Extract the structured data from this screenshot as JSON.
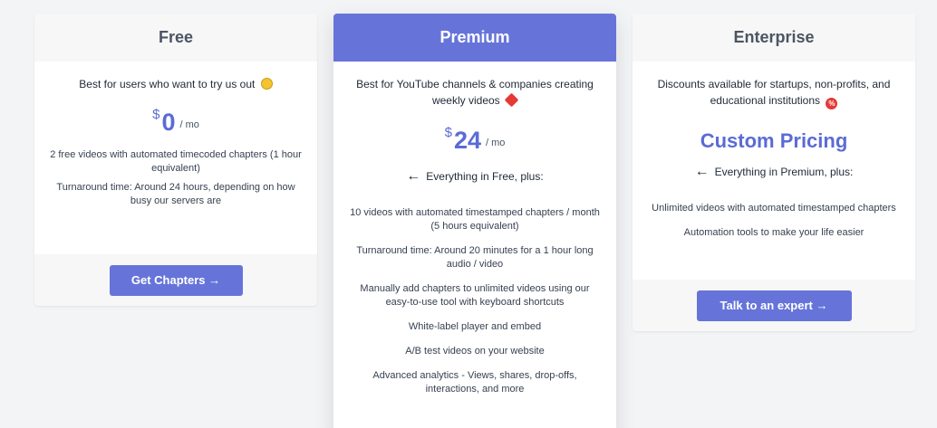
{
  "plans": {
    "free": {
      "name": "Free",
      "tagline": "Best for users who want to try us out",
      "currency": "$",
      "amount": "0",
      "period": "/ mo",
      "features": [
        "2 free videos with automated timecoded chapters (1 hour equivalent)",
        "Turnaround time: Around 24 hours, depending on how busy our servers are"
      ],
      "cta": "Get Chapters →"
    },
    "premium": {
      "name": "Premium",
      "tagline": "Best for YouTube channels & companies creating weekly videos",
      "currency": "$",
      "amount": "24",
      "period": "/ mo",
      "plus": "Everything in Free, plus:",
      "features": [
        "10 videos with automated timestamped chapters / month (5 hours equivalent)",
        "Turnaround time: Around 20 minutes for a 1 hour long audio / video",
        "Manually add chapters to unlimited videos using our easy-to-use tool with keyboard shortcuts",
        "White-label player and embed",
        "A/B test videos on your website",
        "Advanced analytics - Views, shares, drop-offs, interactions, and more"
      ]
    },
    "enterprise": {
      "name": "Enterprise",
      "tagline": "Discounts available for startups, non-profits, and educational institutions",
      "price_label": "Custom Pricing",
      "plus": "Everything in Premium, plus:",
      "features": [
        "Unlimited videos with automated timestamped chapters",
        "Automation tools to make your life easier"
      ],
      "cta": "Talk to an expert →"
    }
  },
  "icons": {
    "arrow": "←",
    "smile_emoji": "smiling-face-emoji",
    "superman_emoji": "superhero-emoji",
    "percent_emoji": "percent-badge-emoji"
  },
  "colors": {
    "accent": "#6674d9",
    "price": "#5b6bd6",
    "background": "#f3f4f6"
  }
}
